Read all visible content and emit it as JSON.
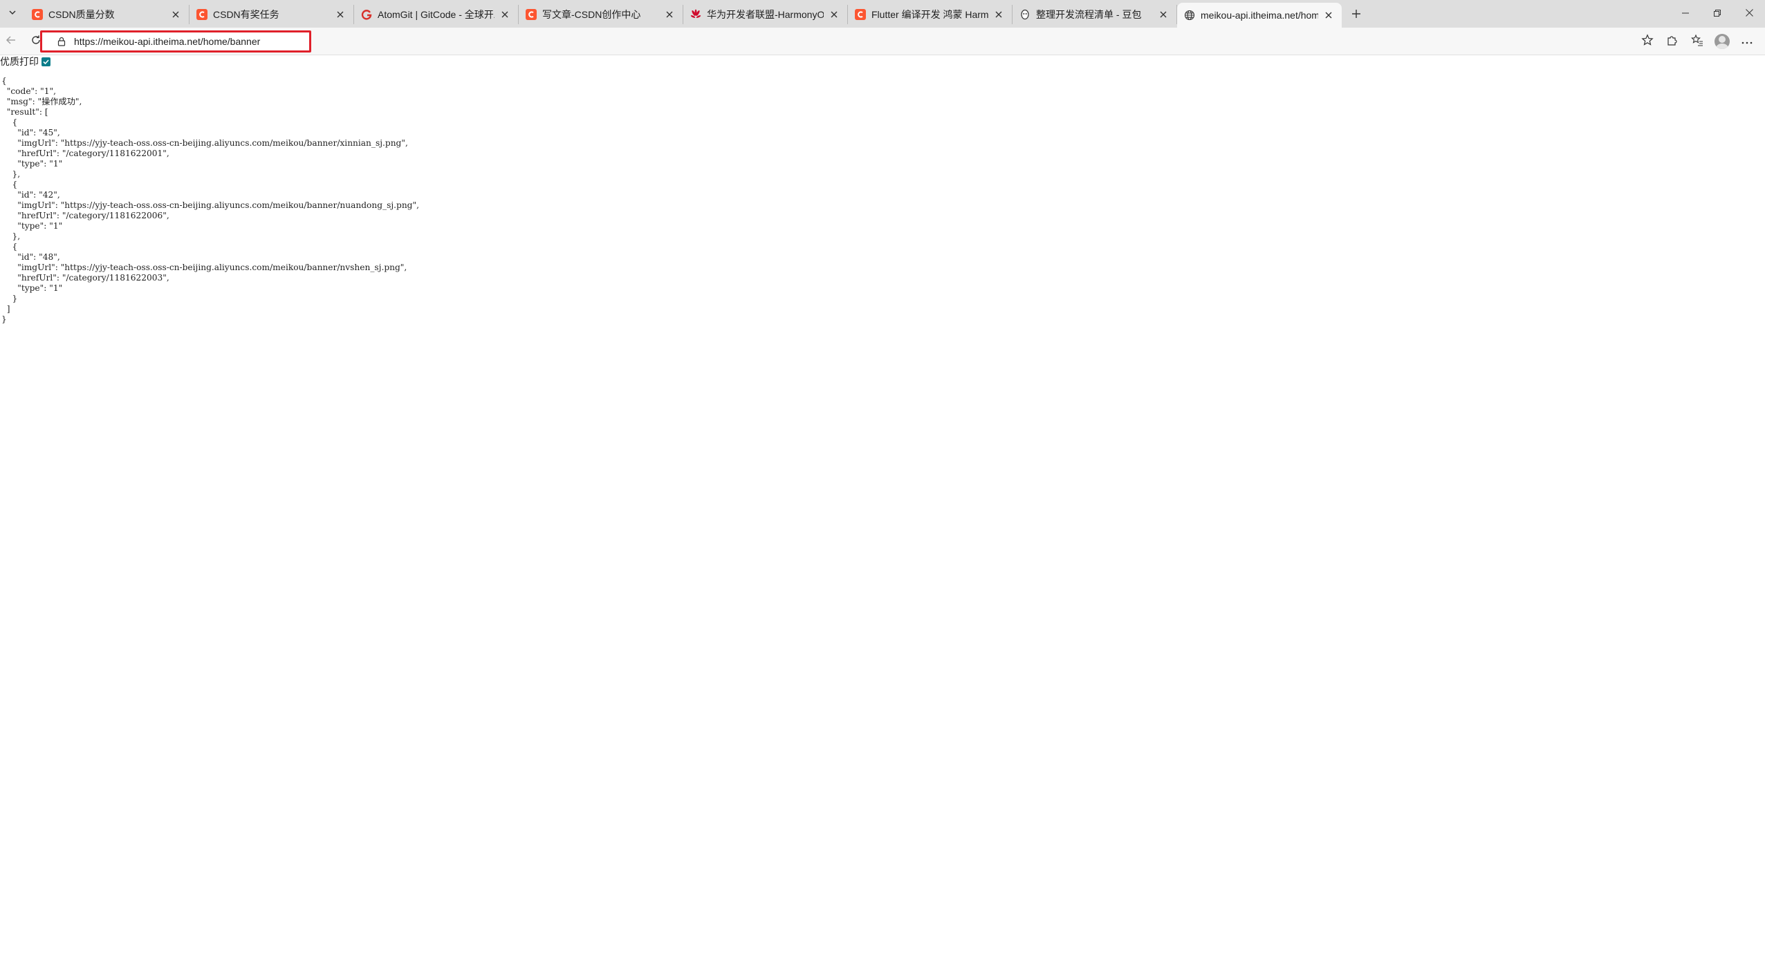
{
  "browser": {
    "tabs": [
      {
        "title": "CSDN质量分数",
        "icon": "csdn-icon",
        "active": false
      },
      {
        "title": "CSDN有奖任务",
        "icon": "csdn-icon",
        "active": false
      },
      {
        "title": "AtomGit | GitCode - 全球开发者的",
        "icon": "gitcode-icon",
        "active": false
      },
      {
        "title": "写文章-CSDN创作中心",
        "icon": "csdn-icon",
        "active": false
      },
      {
        "title": "华为开发者联盟-HarmonyOS开发",
        "icon": "huawei-icon",
        "active": false
      },
      {
        "title": "Flutter 编译开发 鸿蒙 HarmonyOS",
        "icon": "csdn-icon",
        "active": false
      },
      {
        "title": "整理开发流程清单 - 豆包",
        "icon": "doubao-icon",
        "active": false
      },
      {
        "title": "meikou-api.itheima.net/home/banner",
        "icon": "globe-icon",
        "active": true
      }
    ],
    "address": "https://meikou-api.itheima.net/home/banner",
    "accent_color": "#e0202a"
  },
  "pretty_print": {
    "label": "优质打印",
    "checked": true
  },
  "response": {
    "code": "1",
    "msg": "操作成功",
    "result": [
      {
        "id": "45",
        "imgUrl": "https://yjy-teach-oss.oss-cn-beijing.aliyuncs.com/meikou/banner/xinnian_sj.png",
        "hrefUrl": "/category/1181622001",
        "type": "1"
      },
      {
        "id": "42",
        "imgUrl": "https://yjy-teach-oss.oss-cn-beijing.aliyuncs.com/meikou/banner/nuandong_sj.png",
        "hrefUrl": "/category/1181622006",
        "type": "1"
      },
      {
        "id": "48",
        "imgUrl": "https://yjy-teach-oss.oss-cn-beijing.aliyuncs.com/meikou/banner/nvshen_sj.png",
        "hrefUrl": "/category/1181622003",
        "type": "1"
      }
    ]
  }
}
